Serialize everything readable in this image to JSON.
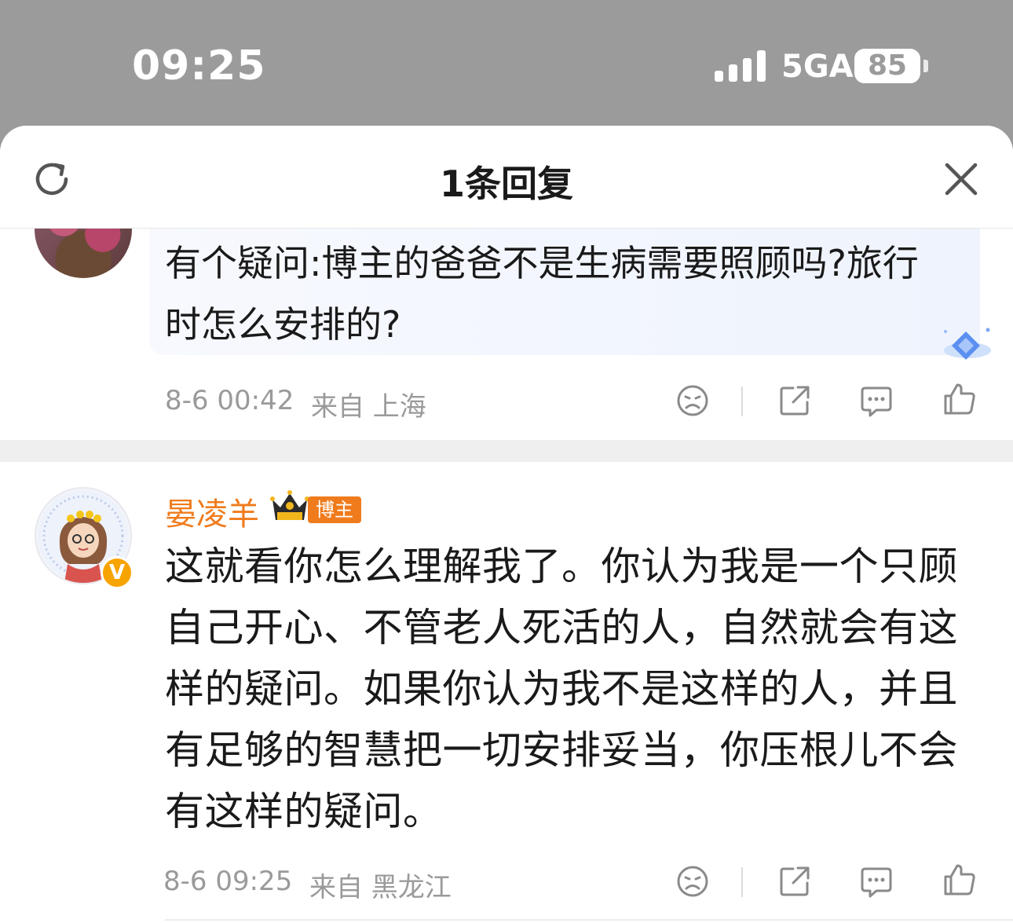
{
  "status_bar": {
    "time": "09:25",
    "network": "5GA",
    "battery": "85"
  },
  "sheet": {
    "title": "1条回复"
  },
  "parent_comment": {
    "text": "有个疑问:博主的爸爸不是生病需要照顾吗?旅行时怎么安排的?",
    "date": "8-6 00:42",
    "location": "来自 上海"
  },
  "reply": {
    "username": "晏凌羊",
    "author_badge": "博主",
    "verified_mark": "V",
    "text": "这就看你怎么理解我了。你认为我是一个只顾自己开心、不管老人死活的人，自然就会有这样的疑问。如果你认为我不是这样的人，并且有足够的智慧把一切安排妥当，你压根儿不会有这样的疑问。",
    "date": "8-6 09:25",
    "location": "来自 黑龙江"
  },
  "colors": {
    "accent": "#f07b1c",
    "meta_text": "#9a9a9a",
    "verified": "#f7a400"
  },
  "icons": [
    "refresh-icon",
    "close-icon",
    "dislike-icon",
    "share-icon",
    "comment-icon",
    "like-icon",
    "crown-icon",
    "diamond-icon"
  ]
}
